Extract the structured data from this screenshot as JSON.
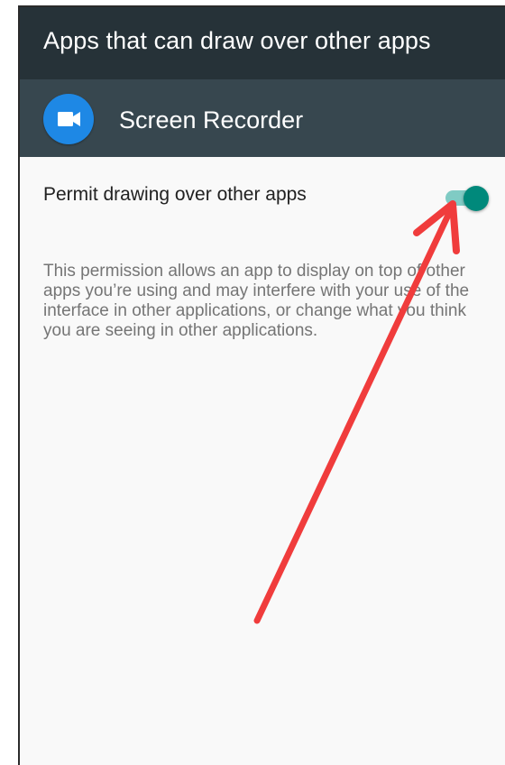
{
  "toolbar": {
    "title": "Apps that can draw over other apps"
  },
  "app": {
    "name": "Screen Recorder",
    "icon": "videocam-icon",
    "icon_color": "#1e88e5"
  },
  "setting": {
    "label": "Permit drawing over other apps",
    "enabled": true,
    "toggle_color": "#00897b"
  },
  "description": "This permission allows an app to display on top of other apps you’re using and may interfere with your use of the interface in other applications, or change what you think you are seeing in other applications.",
  "annotation": {
    "arrow_color": "#f03c3c"
  }
}
